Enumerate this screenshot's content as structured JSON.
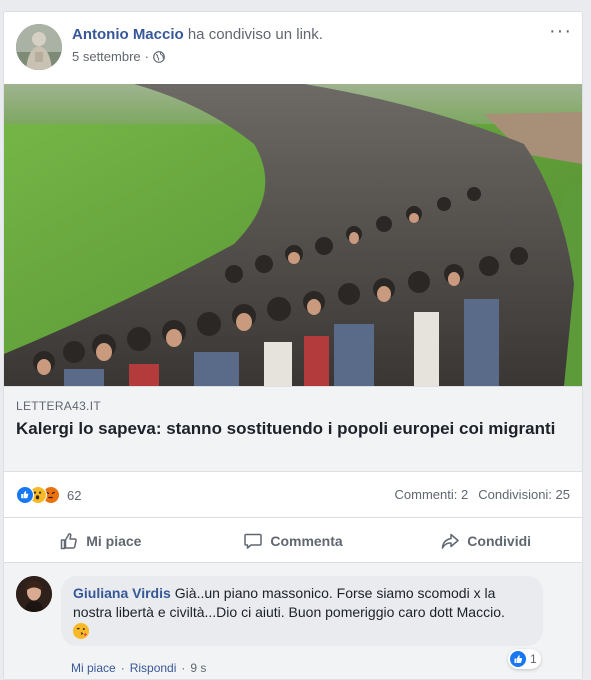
{
  "post": {
    "author": "Antonio Maccio",
    "action_text": "ha condiviso un link.",
    "date": "5 settembre",
    "separator": "·",
    "more_label": "···",
    "icons": {
      "privacy": "globe-icon",
      "more": "more-options-icon"
    }
  },
  "link": {
    "domain": "LETTERA43.IT",
    "title": "Kalergi lo sapeva: stanno sostituendo i popoli europei coi migranti"
  },
  "stats": {
    "reaction_count": "62",
    "reaction_icons": [
      "like-reaction-icon",
      "wow-reaction-icon",
      "angry-reaction-icon"
    ],
    "comments": "Commenti: 2",
    "shares": "Condivisioni: 25"
  },
  "actions": {
    "like": "Mi piace",
    "comment": "Commenta",
    "share": "Condividi"
  },
  "comment": {
    "author": "Giuliana Virdis",
    "text": "Già..un piano massonico. Forse siamo scomodi x la nostra libertà e civiltà...Dio ci aiuti. Buon pomeriggio caro dott Maccio.",
    "emoji": "face-blowing-kiss-emoji",
    "like_label": "Mi piace",
    "reply_label": "Rispondi",
    "separator": "·",
    "time": "9 s",
    "reaction_count": "1"
  },
  "colors": {
    "link_blue": "#365899",
    "like_blue": "#1877f2",
    "background": "#e9ebee"
  }
}
